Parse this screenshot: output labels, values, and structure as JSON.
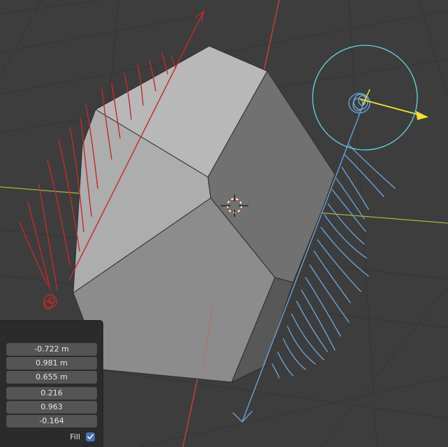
{
  "viewport": {
    "colors": {
      "background": "#3d3d3d",
      "grid_line": "#353535",
      "x_axis": "#c9403c",
      "y_axis": "#a7b832",
      "mesh_light": "#b4b4b4",
      "mesh_dark": "#717171",
      "annotation_red": "#c42a2a",
      "annotation_blue": "#6aa2d4",
      "gizmo_circle": "#63d6e0",
      "arrow_yellow": "#f2e22c"
    }
  },
  "operator_panel": {
    "location": [
      "-0.722 m",
      "0.981 m",
      "0.655 m"
    ],
    "direction": [
      "0.216",
      "0.963",
      "-0.164"
    ],
    "fill_label": "Fill",
    "fill_checked": true
  }
}
